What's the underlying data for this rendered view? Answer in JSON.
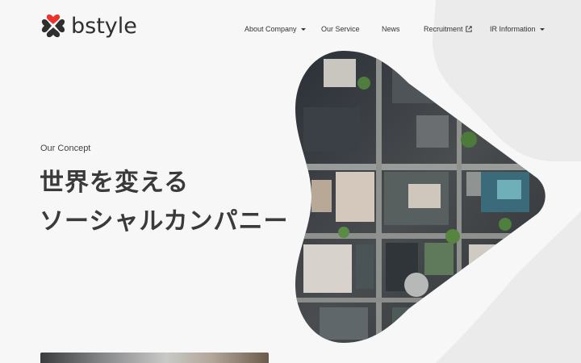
{
  "header": {
    "logo_text": "bstyle",
    "nav": [
      {
        "label": "About Company",
        "indicator": "caret"
      },
      {
        "label": "Our Service",
        "indicator": "none"
      },
      {
        "label": "News",
        "indicator": "none"
      },
      {
        "label": "Recruitment",
        "indicator": "external-link-icon"
      },
      {
        "label": "IR Information",
        "indicator": "caret"
      }
    ]
  },
  "hero": {
    "eyebrow": "Our Concept",
    "headline_line1": "世界を変える",
    "headline_line2": "ソーシャルカンパニー"
  },
  "colors": {
    "logo_heart": "#e8342d",
    "logo_leaf": "#2f2f2f",
    "background": "#f7f7f7",
    "background_shape": "#ebebeb",
    "text": "#333333"
  }
}
